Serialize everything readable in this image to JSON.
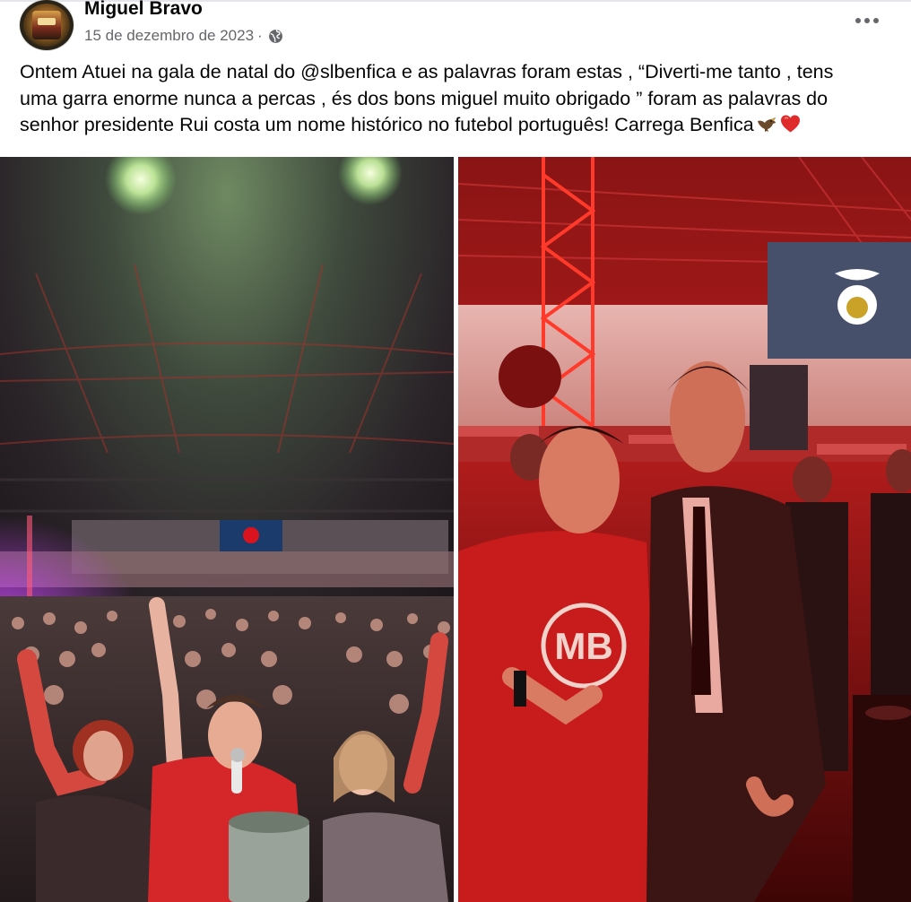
{
  "post": {
    "author": "Miguel Bravo",
    "date": "15 de dezembro de 2023",
    "separator": "·",
    "privacy_icon": "globe-icon",
    "more_icon": "more-options-icon",
    "text_lines": [
      "Ontem  Atuei na gala de natal do @slbenfica e as palavras foram estas , “Diverti-me tanto , tens",
      "uma garra enorme nunca a percas , és dos bons miguel muito obrigado ” foram as palavras do",
      "senhor presidente Rui costa um nome histórico no futebol português! Carrega Benfica"
    ],
    "emojis": [
      "eagle-emoji",
      "red-heart-emoji"
    ]
  },
  "photos": [
    {
      "name": "stage-selfie-photo",
      "icon": "photo"
    },
    {
      "name": "posed-photo",
      "icon": "photo",
      "shirt_logo": "MB"
    }
  ],
  "colors": {
    "text": "#050505",
    "secondary_text": "#65676b",
    "benfica_red": "#d9141e"
  }
}
